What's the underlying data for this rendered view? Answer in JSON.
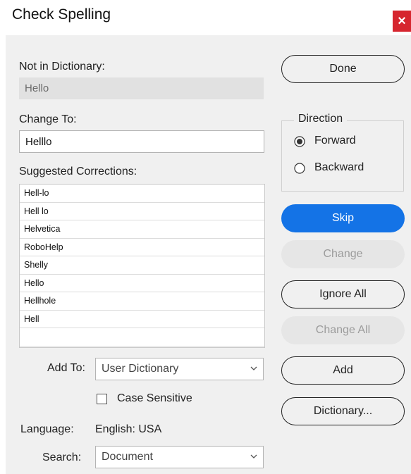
{
  "window": {
    "title": "Check Spelling",
    "close_glyph": "×"
  },
  "not_in_dictionary": {
    "label": "Not in Dictionary:",
    "value": "Hello"
  },
  "change_to": {
    "label": "Change To:",
    "value": "Helllo"
  },
  "suggestions": {
    "label": "Suggested Corrections:",
    "items": [
      "Hell-lo",
      "Hell lo",
      "Helvetica",
      "RoboHelp",
      "Shelly",
      "Hello",
      "Hellhole",
      "Hell"
    ]
  },
  "add_to": {
    "label": "Add To:",
    "value": "User Dictionary"
  },
  "case_sensitive": {
    "label": "Case Sensitive",
    "checked": false
  },
  "language": {
    "label": "Language:",
    "value": "English: USA"
  },
  "search": {
    "label": "Search:",
    "value": "Document"
  },
  "direction": {
    "title": "Direction",
    "forward_label": "Forward",
    "backward_label": "Backward",
    "selected": "Forward"
  },
  "buttons": {
    "done": "Done",
    "skip": "Skip",
    "change": "Change",
    "ignore_all": "Ignore All",
    "change_all": "Change All",
    "add": "Add",
    "dictionary": "Dictionary..."
  },
  "colors": {
    "accent": "#1473e6",
    "close": "#d6262f",
    "panel": "#f0f0f0"
  }
}
